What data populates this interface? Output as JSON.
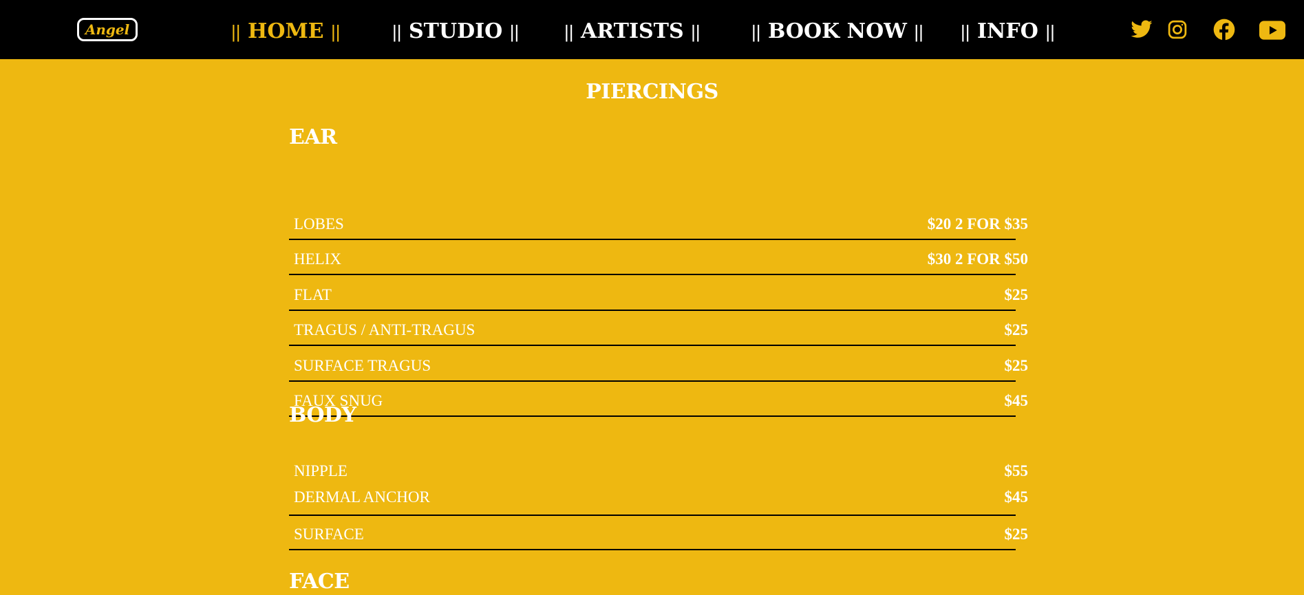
{
  "nav": {
    "logo": "Angel",
    "bars": "||",
    "items": [
      {
        "label": "HOME",
        "active": true
      },
      {
        "label": "STUDIO"
      },
      {
        "label": "ARTISTS"
      },
      {
        "label": "BOOK NOW"
      },
      {
        "label": "INFO"
      }
    ],
    "social_icons": [
      "twitter-icon",
      "instagram-icon",
      "facebook-icon",
      "youtube-icon"
    ],
    "accent_color": "#eeb811"
  },
  "page": {
    "title": "PIERCINGS",
    "background_color": "#eeb811"
  },
  "ear": {
    "title": "EAR",
    "items": [
      {
        "name": "LOBES",
        "price": "$20 2 FOR $35"
      },
      {
        "name": "HELIX",
        "price": "$30 2 FOR $50"
      },
      {
        "name": "FLAT",
        "price": "$25"
      },
      {
        "name": "TRAGUS / ANTI-TRAGUS",
        "price": "$25"
      },
      {
        "name": "SURFACE TRAGUS",
        "price": "$25"
      },
      {
        "name": "FAUX SNUG",
        "price": "$45"
      }
    ]
  },
  "body": {
    "title": "BODY",
    "items": [
      {
        "name": "NIPPLE",
        "price": "$55"
      },
      {
        "name": "DERMAL ANCHOR",
        "price": "$45"
      },
      {
        "name": "SURFACE",
        "price": "$25"
      }
    ]
  },
  "face": {
    "title": "FACE"
  }
}
